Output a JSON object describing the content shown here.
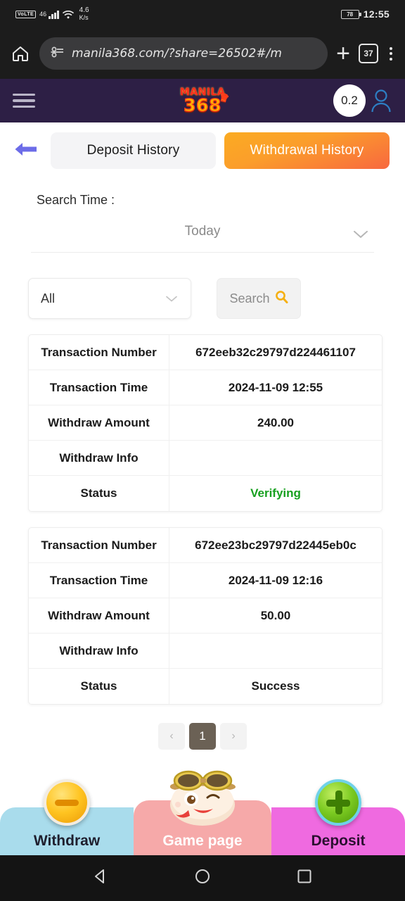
{
  "status_bar": {
    "volte": "VoLTE",
    "network": "46",
    "data_rate": "4.6",
    "data_rate_unit": "K/s",
    "battery": "78",
    "time": "12:55"
  },
  "browser": {
    "home_icon": "home-icon",
    "url": "manila368.com/?share=26502#/m",
    "lock_icon": "permissions-icon",
    "new_tab_icon": "plus-icon",
    "tab_count": "37",
    "menu_icon": "more-vertical-icon"
  },
  "app_header": {
    "menu_icon": "hamburger-icon",
    "logo_top": "MANILA",
    "logo_bottom": "368",
    "crown_icon": "crown-icon",
    "balance": "0.2",
    "avatar_icon": "user-avatar-icon",
    "bg_color": "#2d1f45"
  },
  "tabs": {
    "back_icon": "back-arrow-icon",
    "items": [
      {
        "label": "Deposit History",
        "active": false
      },
      {
        "label": "Withdrawal History",
        "active": true
      }
    ],
    "active_color": "#fb9e2b"
  },
  "filters": {
    "search_time_label": "Search Time :",
    "time_value": "Today",
    "time_chevron": "chevron-down-icon",
    "type_value": "All",
    "type_chevron": "chevron-down-icon",
    "search_label": "Search",
    "search_icon": "search-icon",
    "search_icon_color": "#f5b014"
  },
  "table": {
    "keys": {
      "transaction_number": "Transaction Number",
      "transaction_time": "Transaction Time",
      "withdraw_amount": "Withdraw Amount",
      "withdraw_info": "Withdraw Info",
      "status": "Status"
    },
    "rows": [
      {
        "transaction_number": "672eeb32c29797d224461107",
        "transaction_time": "2024-11-09 12:55",
        "withdraw_amount": "240.00",
        "withdraw_info": "",
        "status": "Verifying",
        "status_color": "#17a01f"
      },
      {
        "transaction_number": "672ee23bc29797d22445eb0c",
        "transaction_time": "2024-11-09 12:16",
        "withdraw_amount": "50.00",
        "withdraw_info": "",
        "status": "Success",
        "status_color": "#1b1b1b"
      }
    ]
  },
  "pagination": {
    "prev_icon": "chevron-left-icon",
    "current_page": "1",
    "next_icon": "chevron-right-icon"
  },
  "bottom_nav": [
    {
      "label": "Withdraw",
      "icon": "minus-coin-icon",
      "bg_color": "#a9dcec"
    },
    {
      "label": "Game page",
      "icon": "mascot-icon",
      "bg_color": "#f6a9a9"
    },
    {
      "label": "Deposit",
      "icon": "plus-coin-icon",
      "bg_color": "#ef6ae0"
    }
  ],
  "android_nav": {
    "back_icon": "android-back-icon",
    "home_icon": "android-home-icon",
    "recents_icon": "android-recents-icon"
  }
}
